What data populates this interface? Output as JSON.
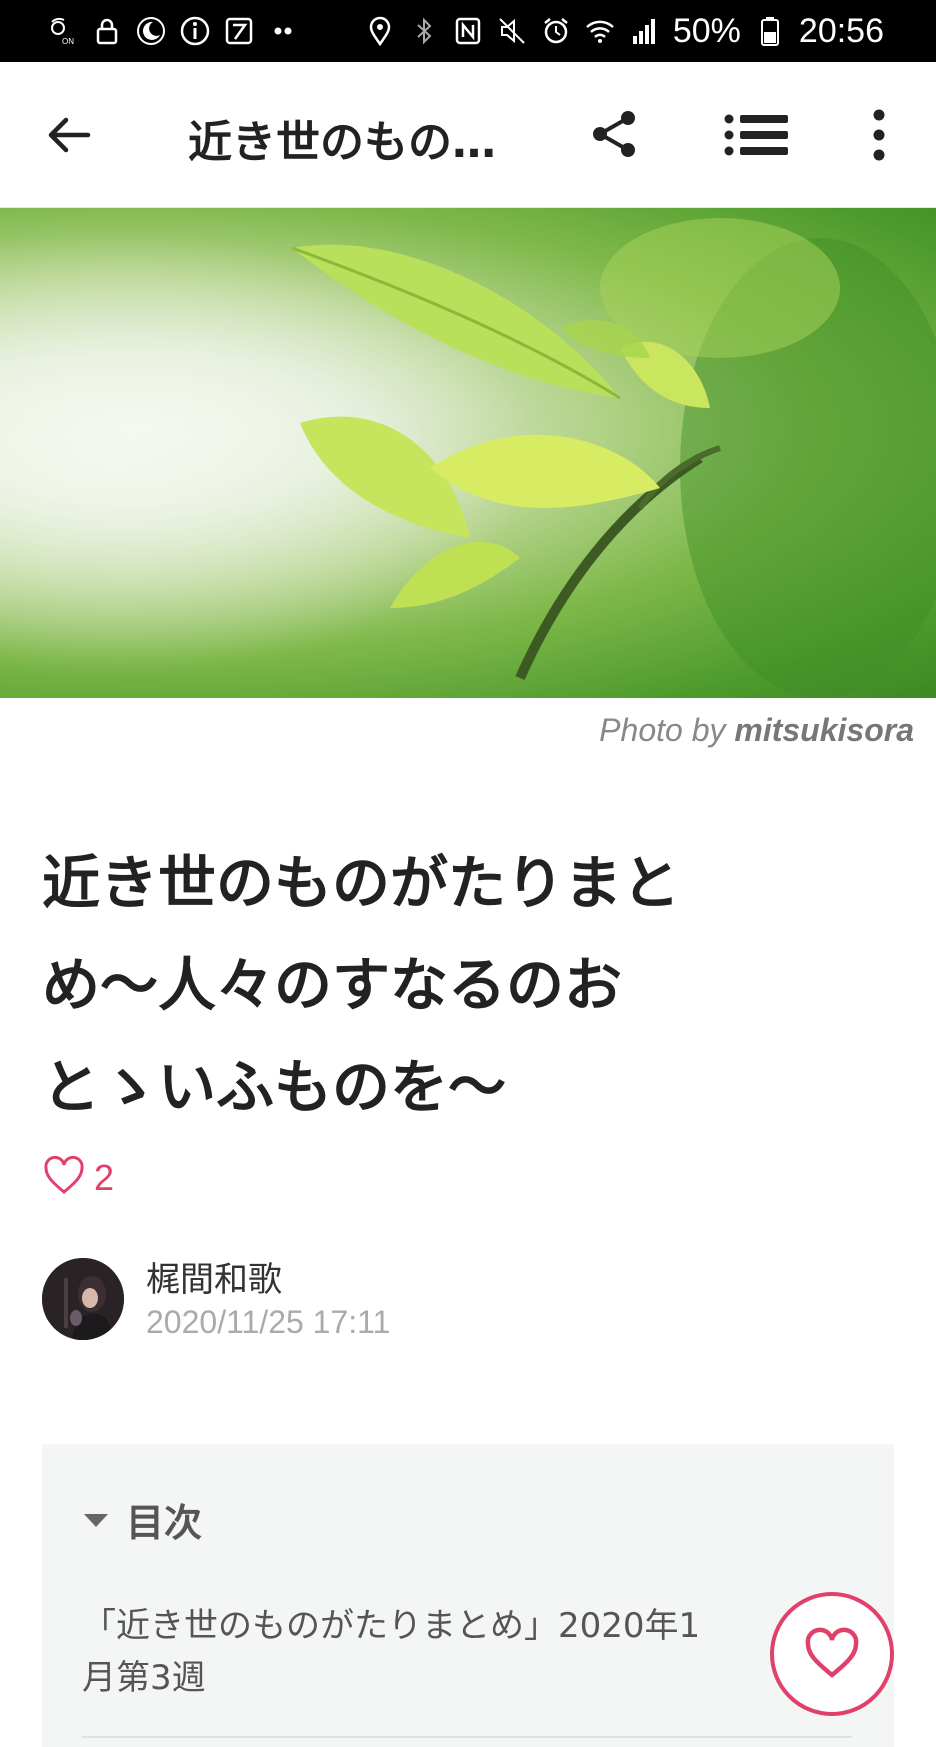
{
  "status_bar": {
    "battery_percent": "50%",
    "time": "20:56",
    "left_icons": [
      "nfc-on-icon",
      "lock-icon",
      "moon-icon",
      "info-icon",
      "app-icon",
      "dots-icon"
    ],
    "right_icons": [
      "location-icon",
      "bluetooth-icon",
      "nfc-icon",
      "mute-icon",
      "alarm-icon",
      "wifi-icon",
      "signal-icon",
      "battery-icon"
    ]
  },
  "app_bar": {
    "title": "近き世のもの…",
    "icons": [
      "back-arrow-icon",
      "share-icon",
      "table-of-contents-icon",
      "more-vert-icon"
    ]
  },
  "hero": {
    "credit_prefix": "Photo by",
    "credit_name": "mitsukisora"
  },
  "article": {
    "title_lines": [
      "近き世のものがたりまと",
      "め〜人々のすなるのお",
      "とゝいふものを〜"
    ],
    "like_count": "2"
  },
  "author": {
    "name": "梶間和歌",
    "date": "2020/11/25 17:11"
  },
  "toc": {
    "title": "目次",
    "items": [
      "「近き世のものがたりまとめ」2020年1",
      "月第3週"
    ]
  },
  "colors": {
    "accent": "#e0406a",
    "status_bar_bg": "#000000",
    "toc_bg": "#f4f6f6"
  }
}
